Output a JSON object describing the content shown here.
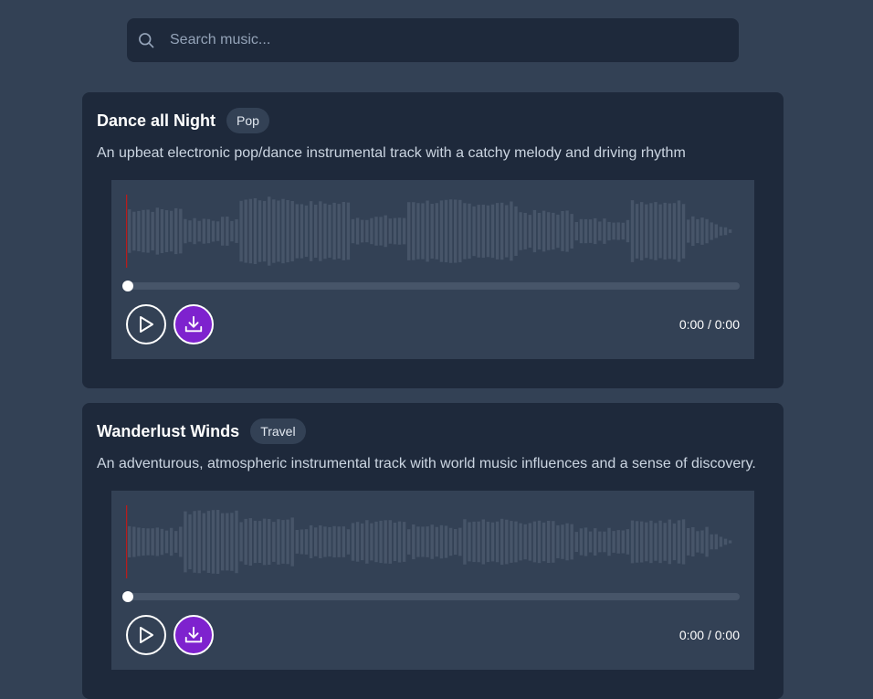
{
  "search": {
    "placeholder": "Search music..."
  },
  "tracks": [
    {
      "title": "Dance all Night",
      "genre": "Pop",
      "description": "An upbeat electronic pop/dance instrumental track with a catchy melody and driving rhythm",
      "time": "0:00 / 0:00",
      "progress": 0,
      "seed": 7
    },
    {
      "title": "Wanderlust Winds",
      "genre": "Travel",
      "description": "An adventurous, atmospheric instrumental track with world music influences and a sense of discovery.",
      "time": "0:00 / 0:00",
      "progress": 0,
      "seed": 23
    }
  ],
  "colors": {
    "background": "#334155",
    "card": "#1e293b",
    "waveform": "#475569",
    "playhead": "#b91c1c",
    "accent": "#7e22ce"
  }
}
